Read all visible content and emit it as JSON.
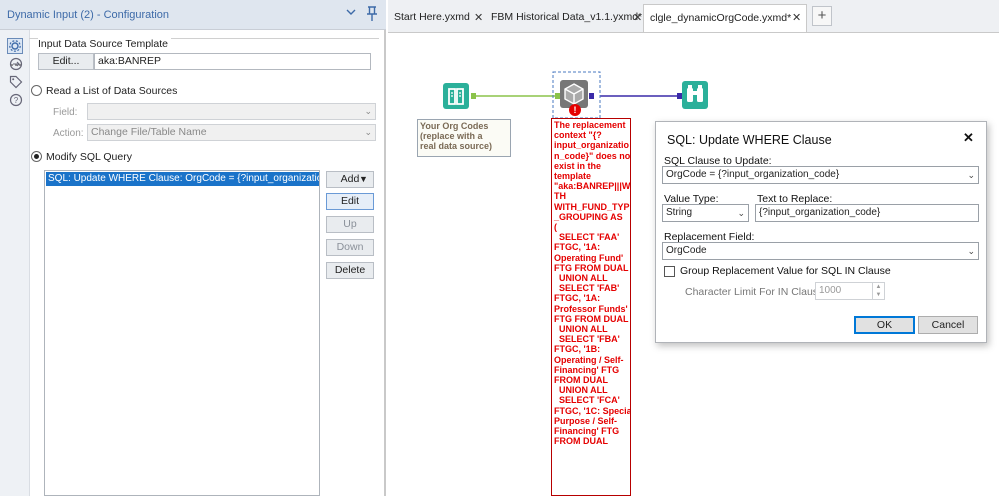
{
  "config_panel": {
    "title": "Dynamic Input (2) - Configuration",
    "template_section": "Input Data Source Template",
    "edit_button": "Edit...",
    "template_value": "aka:BANREP",
    "read_list_option": "Read a List of Data Sources",
    "field_label": "Field:",
    "field_value": "",
    "action_label": "Action:",
    "action_value": "Change File/Table Name",
    "modify_sql_option": "Modify SQL Query",
    "rule_item": "SQL: Update WHERE Clause: OrgCode = {?input_organization_code}",
    "buttons": {
      "add": "Add",
      "edit": "Edit",
      "up": "Up",
      "down": "Down",
      "delete": "Delete"
    }
  },
  "tabs": [
    {
      "label": "Start Here.yxmd",
      "active": false
    },
    {
      "label": "FBM Historical Data_v1.1.yxmd*",
      "active": false
    },
    {
      "label": "clgle_dynamicOrgCode.yxmd*",
      "active": true
    }
  ],
  "canvas": {
    "input_annotation": "Your Org Codes\n(replace with a\nreal data source)",
    "error_annotation": "The replacement\ncontext \"{?\ninput_organizatio\nn_code}\" does not\nexist in the\ntemplate\n\"aka:BANREP|||WI\nTH\nWITH_FUND_TYPE\n_GROUPING AS\n(\n  SELECT 'FAA'\nFTGC, '1A:\nOperating Fund'\nFTG FROM DUAL\n  UNION ALL\n  SELECT 'FAB'\nFTGC, '1A:\nProfessor Funds'\nFTG FROM DUAL\n  UNION ALL\n  SELECT 'FBA'\nFTGC, '1B:\nOperating / Self-\nFinancing' FTG\nFROM DUAL\n  UNION ALL\n  SELECT 'FCA'\nFTGC, '1C: Special\nPurpose / Self-\nFinancing' FTG\nFROM DUAL"
  },
  "dialog": {
    "title": "SQL: Update WHERE Clause",
    "clause_label": "SQL Clause to Update:",
    "clause_value": "OrgCode = {?input_organization_code}",
    "value_type_label": "Value Type:",
    "value_type_value": "String",
    "text_replace_label": "Text to Replace:",
    "text_replace_value": "{?input_organization_code}",
    "replacement_field_label": "Replacement Field:",
    "replacement_field_value": "OrgCode",
    "group_checkbox_label": "Group Replacement Value for SQL IN Clause",
    "char_limit_label": "Character Limit For IN Clause:",
    "char_limit_value": "1000",
    "ok": "OK",
    "cancel": "Cancel"
  },
  "colors": {
    "accent": "#1a73c9",
    "tool_green": "#2bb09a",
    "error": "#e50000",
    "connection_purple": "#3a2aa8"
  }
}
